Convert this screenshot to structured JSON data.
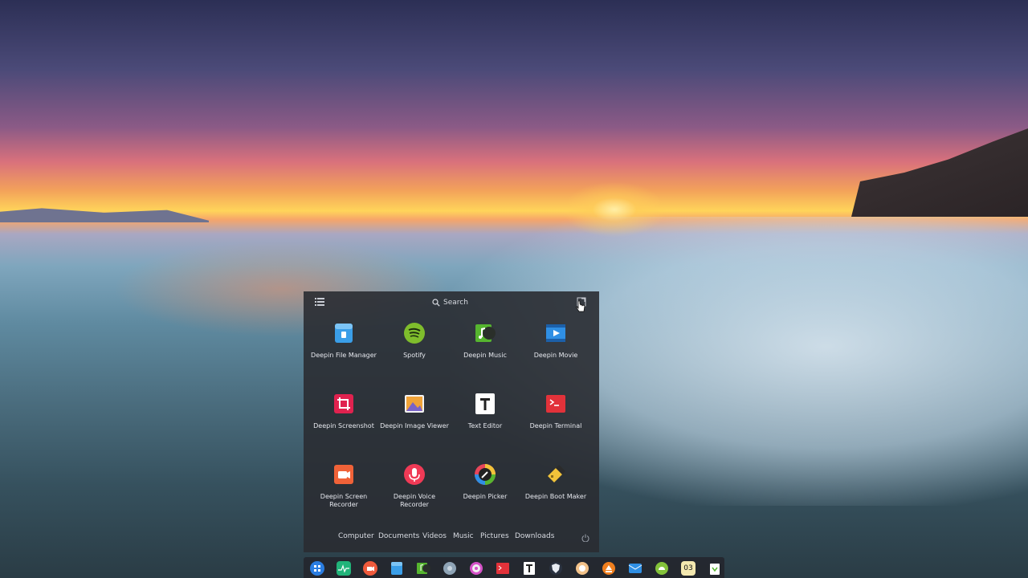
{
  "launcher": {
    "search_label": "Search",
    "apps": [
      {
        "label": "Deepin File Manager",
        "icon": "file-manager-icon",
        "color": "#3a9ee8"
      },
      {
        "label": "Spotify",
        "icon": "spotify-icon",
        "color": "#7fbd2c"
      },
      {
        "label": "Deepin Music",
        "icon": "music-icon",
        "color": "#56b52f"
      },
      {
        "label": "Deepin Movie",
        "icon": "movie-icon",
        "color": "#2f8fe4"
      },
      {
        "label": "Deepin Screenshot",
        "icon": "screenshot-icon",
        "color": "#e0224f"
      },
      {
        "label": "Deepin Image Viewer",
        "icon": "image-viewer-icon",
        "color": "#f0a338"
      },
      {
        "label": "Text Editor",
        "icon": "text-editor-icon",
        "color": "#ffffff"
      },
      {
        "label": "Deepin Terminal",
        "icon": "terminal-icon",
        "color": "#e2323a"
      },
      {
        "label": "Deepin Screen Recorder",
        "icon": "screen-recorder-icon",
        "color": "#f06238"
      },
      {
        "label": "Deepin Voice Recorder",
        "icon": "voice-recorder-icon",
        "color": "#f03a56"
      },
      {
        "label": "Deepin Picker",
        "icon": "color-picker-icon",
        "color": "#222222"
      },
      {
        "label": "Deepin Boot Maker",
        "icon": "boot-maker-icon",
        "color": "#f2c33a"
      }
    ],
    "footer": [
      "Computer",
      "Documents",
      "Videos",
      "Music",
      "Pictures",
      "Downloads"
    ]
  },
  "dock": {
    "items": [
      {
        "icon": "launcher-icon",
        "color": "#2a7de1"
      },
      {
        "icon": "system-monitor-icon",
        "color": "#22b47a"
      },
      {
        "icon": "screen-recorder-icon",
        "color": "#ef5a3c"
      },
      {
        "icon": "file-manager-icon",
        "color": "#3a9ee8"
      },
      {
        "icon": "music-icon",
        "color": "#56b52f"
      },
      {
        "icon": "disk-icon",
        "color": "#8fa4b6"
      },
      {
        "icon": "settings-icon",
        "color": "#d552c8"
      },
      {
        "icon": "terminal-icon",
        "color": "#e2323a"
      },
      {
        "icon": "text-editor-icon",
        "color": "#ffffff"
      },
      {
        "icon": "security-icon",
        "color": "#2a3240"
      },
      {
        "icon": "browser-icon",
        "color": "#f2c28a"
      },
      {
        "icon": "store-icon",
        "color": "#f07f1e"
      },
      {
        "icon": "mail-icon",
        "color": "#2f8fe4"
      },
      {
        "icon": "android-icon",
        "color": "#83c23a"
      },
      {
        "icon": "clock-icon",
        "color": "#f3e8b0"
      },
      {
        "icon": "trash-icon",
        "color": "#ffffff"
      }
    ],
    "clock_text": "03"
  }
}
